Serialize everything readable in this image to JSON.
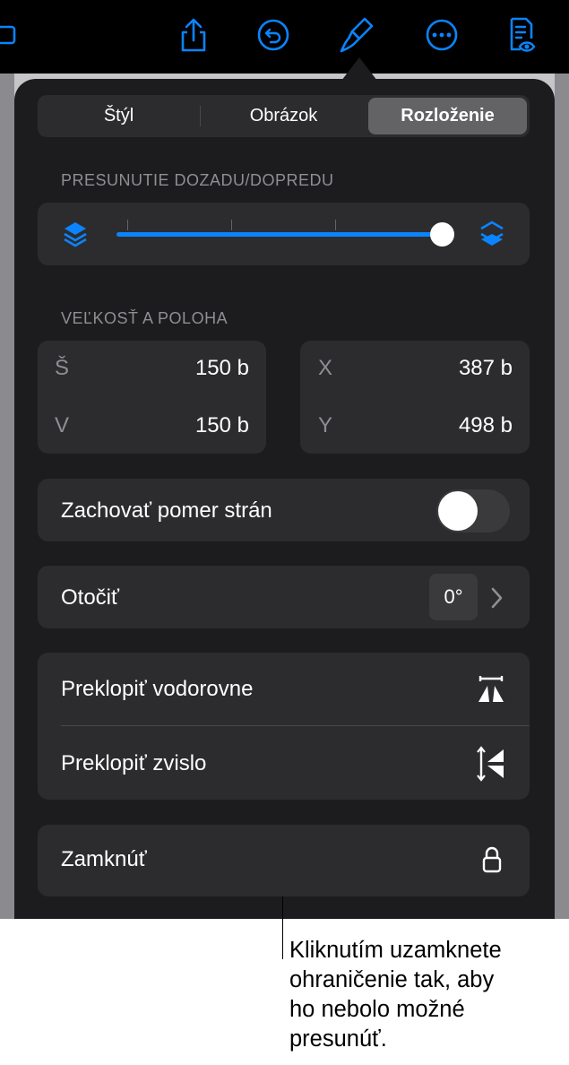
{
  "segments": [
    "Štýl",
    "Obrázok",
    "Rozloženie"
  ],
  "arrange": {
    "label": "PRESUNUTIE DOZADU/DOPREDU",
    "value_fraction": 1.0
  },
  "size_position": {
    "label": "VEĽKOSŤ A POLOHA",
    "width_label": "Š",
    "width_value": "150 b",
    "height_label": "V",
    "height_value": "150 b",
    "x_label": "X",
    "x_value": "387 b",
    "y_label": "Y",
    "y_value": "498 b"
  },
  "constrain": {
    "label": "Zachovať pomer strán",
    "on": false
  },
  "rotate": {
    "label": "Otočiť",
    "value": "0°"
  },
  "flip": {
    "horizontal_label": "Preklopiť vodorovne",
    "vertical_label": "Preklopiť zvislo"
  },
  "lock": {
    "label": "Zamknúť"
  },
  "callout": "Kliknutím uzamknete\nohraničenie tak, aby\nho nebolo možné\npresunúť.",
  "colors": {
    "accent": "#0a84ff",
    "panel": "#1c1c1e",
    "card": "#2c2c2e"
  }
}
